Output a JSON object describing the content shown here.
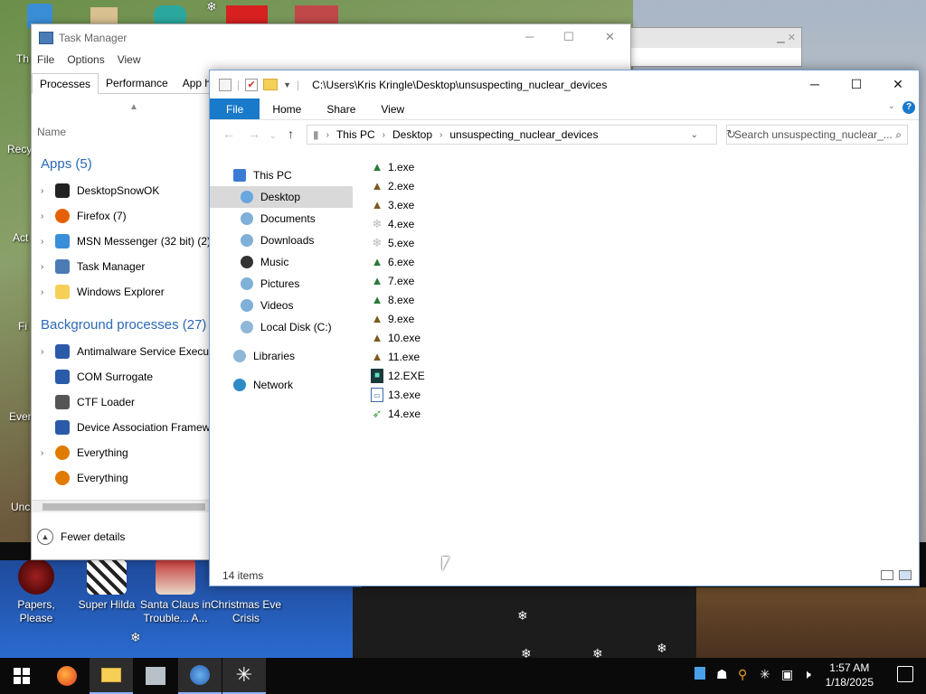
{
  "desktop": {
    "icons": [
      {
        "label": "Papers, Please",
        "id": "papers"
      },
      {
        "label": "Super Hilda",
        "id": "hilda"
      },
      {
        "label": "Santa Claus in Trouble... A...",
        "id": "santa"
      },
      {
        "label": "Christmas Eve Crisis",
        "id": "eve"
      }
    ],
    "partial_labels": [
      "Th",
      "Recy",
      "Act",
      "Fi",
      "Ever",
      "Unc"
    ]
  },
  "task_manager": {
    "title": "Task Manager",
    "menu": [
      "File",
      "Options",
      "View"
    ],
    "tabs": [
      "Processes",
      "Performance",
      "App histo"
    ],
    "column_header": "Name",
    "group_apps": "Apps (5)",
    "apps": [
      {
        "name": "DesktopSnowOK",
        "color": "#222222"
      },
      {
        "name": "Firefox (7)",
        "color": "#e66000"
      },
      {
        "name": "MSN Messenger (32 bit) (2)",
        "color": "#3a8ed8"
      },
      {
        "name": "Task Manager",
        "color": "#4a7bb5"
      },
      {
        "name": "Windows Explorer",
        "color": "#f6cf57"
      }
    ],
    "group_background": "Background processes (27)",
    "background": [
      {
        "name": "Antimalware Service Executa",
        "color": "#2a5aa8",
        "expand": true
      },
      {
        "name": "COM Surrogate",
        "color": "#2a5aa8",
        "expand": false
      },
      {
        "name": "CTF Loader",
        "color": "#555555",
        "expand": false
      },
      {
        "name": "Device Association Framew",
        "color": "#2a5aa8",
        "expand": false
      },
      {
        "name": "Everything",
        "color": "#e07a00",
        "expand": true
      },
      {
        "name": "Everything",
        "color": "#e07a00",
        "expand": false
      }
    ],
    "fewer_details": "Fewer details"
  },
  "explorer": {
    "title_path": "C:\\Users\\Kris Kringle\\Desktop\\unsuspecting_nuclear_devices",
    "ribbon": [
      "File",
      "Home",
      "Share",
      "View"
    ],
    "breadcrumb": [
      "This PC",
      "Desktop",
      "unsuspecting_nuclear_devices"
    ],
    "search_placeholder": "Search unsuspecting_nuclear_...",
    "nav": [
      {
        "label": "This PC",
        "indent": 0,
        "color": "#3a7bd5"
      },
      {
        "label": "Desktop",
        "indent": 1,
        "color": "#6aa6e0",
        "selected": true
      },
      {
        "label": "Documents",
        "indent": 1,
        "color": "#7fb0d8"
      },
      {
        "label": "Downloads",
        "indent": 1,
        "color": "#7fb0d8"
      },
      {
        "label": "Music",
        "indent": 1,
        "color": "#333333"
      },
      {
        "label": "Pictures",
        "indent": 1,
        "color": "#7fb0d8"
      },
      {
        "label": "Videos",
        "indent": 1,
        "color": "#7fb0d8"
      },
      {
        "label": "Local Disk (C:)",
        "indent": 1,
        "color": "#8fb7d8"
      },
      {
        "label": "Libraries",
        "indent": 0,
        "color": "#8fb7d8",
        "gap": true
      },
      {
        "label": "Network",
        "indent": 0,
        "color": "#2f8ac8",
        "gap": true
      }
    ],
    "files": [
      {
        "name": "1.exe",
        "icon": "tree-icon"
      },
      {
        "name": "2.exe",
        "icon": "xmas-tree-icon"
      },
      {
        "name": "3.exe",
        "icon": "xmas-tree-icon"
      },
      {
        "name": "4.exe",
        "icon": "snowflake-icon"
      },
      {
        "name": "5.exe",
        "icon": "snowflake-icon"
      },
      {
        "name": "6.exe",
        "icon": "tree-icon"
      },
      {
        "name": "7.exe",
        "icon": "tree-icon"
      },
      {
        "name": "8.exe",
        "icon": "tree-icon"
      },
      {
        "name": "9.exe",
        "icon": "xmas-tree-icon"
      },
      {
        "name": "10.exe",
        "icon": "xmas-tree-icon"
      },
      {
        "name": "11.exe",
        "icon": "xmas-tree-icon"
      },
      {
        "name": "12.EXE",
        "icon": "game-icon"
      },
      {
        "name": "13.exe",
        "icon": "window-icon"
      },
      {
        "name": "14.exe",
        "icon": "bird-icon"
      }
    ],
    "status": "14 items"
  },
  "taskbar": {
    "clock_time": "1:57 AM",
    "clock_date": "1/18/2025"
  }
}
